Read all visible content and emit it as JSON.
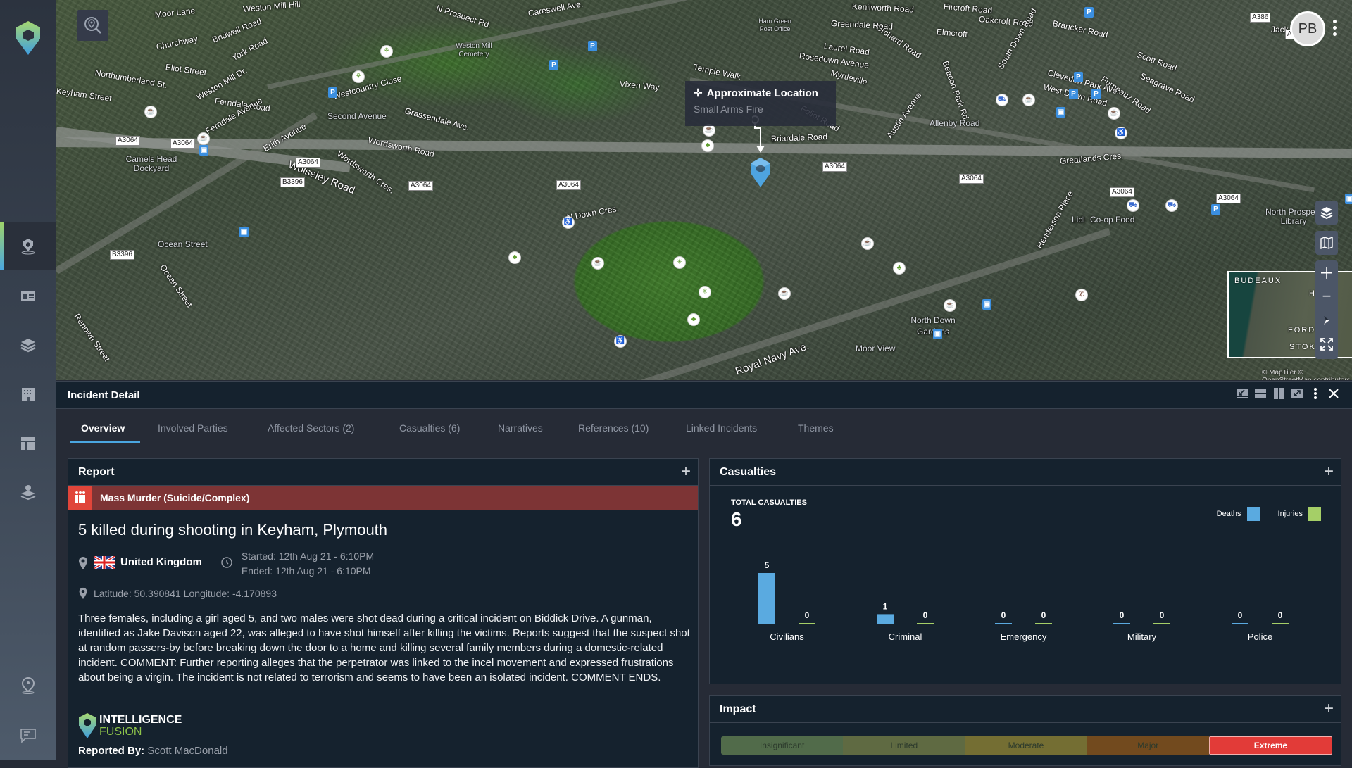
{
  "sidebar": {
    "items": [
      {
        "name": "incidents-map",
        "active": true
      },
      {
        "name": "reports"
      },
      {
        "name": "layers"
      },
      {
        "name": "buildings"
      },
      {
        "name": "dashboard"
      },
      {
        "name": "location-layers"
      }
    ],
    "bottom_items": [
      {
        "name": "my-locations"
      },
      {
        "name": "feedback"
      }
    ]
  },
  "map": {
    "user_initials": "PB",
    "tooltip_title": "Approximate Location",
    "tooltip_subtitle": "Small Arms Fire",
    "attribution": "© MapTiler © OpenStreetMap contributors",
    "minimap_labels": [
      "BUDEAUX",
      "HAM",
      "FORD",
      "STOKE"
    ],
    "street_labels": [
      "Weston Mill Hill",
      "Moor Lane",
      "N Prospect Rd.",
      "Careswell Ave.",
      "Churchway",
      "Bridwell Road",
      "York Road",
      "Eliot Street",
      "Northumberland St.",
      "Keyham Street",
      "Weston Mill Dr.",
      "Ferndale Road",
      "Ferndale Avenue",
      "Westcountry Close",
      "Grassendale Ave.",
      "Wordsworth Road",
      "Wordsworth Cres.",
      "Wolseley Road",
      "Erith Avenue",
      "Vixen Way",
      "Briardale Road",
      "Laurel Road",
      "Rosedown Avenue",
      "Myrtleville",
      "Foliot Road",
      "Austin Avenue",
      "Beacon Park Rd.",
      "Orchard Road",
      "Greendale Road",
      "Kenilworth Road",
      "Fircroft Road",
      "Oakcroft Road",
      "Elmcroft",
      "South Down Road",
      "Brancker Road",
      "Clevedon Park Ave.",
      "West Down Road",
      "Furneaux Road",
      "Scott Road",
      "Seagrave Road",
      "Greatlands Cres.",
      "N Down Cres.",
      "Royal Navy Ave.",
      "Henderson Place",
      "Ocean Street",
      "Renown Street",
      "Temple Walk",
      "Jack Leslie"
    ],
    "poi_labels": [
      "Camels Head Dockyard",
      "Second Avenue",
      "Weston Mill Cemetery",
      "Ham Green Post Office",
      "Allenby Road",
      "Ocean Street",
      "North Down Gardens",
      "Moor View",
      "Lidl",
      "Co-op Food",
      "North Prospect Library"
    ],
    "road_shields": [
      "A3064",
      "B3396",
      "A386"
    ]
  },
  "panel": {
    "title": "Incident Detail",
    "tabs": [
      {
        "label": "Overview",
        "active": true
      },
      {
        "label": "Involved Parties"
      },
      {
        "label": "Affected Sectors (2)"
      },
      {
        "label": "Casualties (6)"
      },
      {
        "label": "Narratives"
      },
      {
        "label": "References (10)"
      },
      {
        "label": "Linked Incidents"
      },
      {
        "label": "Themes"
      }
    ]
  },
  "report": {
    "heading": "Report",
    "category": "Mass Murder (Suicide/Complex)",
    "category_color": "#7d3435",
    "title": "5 killed during shooting in Keyham, Plymouth",
    "country": "United Kingdom",
    "started": "Started: 12th Aug 21 - 6:10PM",
    "ended": "Ended: 12th Aug 21 - 6:10PM",
    "latlng": "Latitude: 50.390841 Longitude: -4.170893",
    "body": "Three females, including a girl aged 5,  and two males were shot dead during a critical incident on Biddick Drive. A gunman, identified as Jake Davison aged 22, was alleged to have shot himself after killing the victims. Reports suggest that the suspect shot at random passers-by before breaking down the door to a home and killing several family members during a domestic-related incident. COMMENT: Further reporting alleges that the perpetrator was linked to the incel movement and expressed frustrations about being a virgin. The incident is not related to terrorism and seems to have been an isolated incident.  COMMENT ENDS.",
    "brand_line1": "INTELLIGENCE",
    "brand_line2": "FUSION",
    "reported_by_label": "Reported By:",
    "reported_by": "Scott MacDonald"
  },
  "casualties": {
    "heading": "Casualties",
    "total_label": "TOTAL CASUALTIES",
    "total": "6",
    "legend": [
      {
        "label": "Deaths",
        "color": "#5aaae0"
      },
      {
        "label": "Injuries",
        "color": "#a5cf67"
      }
    ]
  },
  "chart_data": {
    "type": "bar",
    "categories": [
      "Civilians",
      "Criminal",
      "Emergency",
      "Military",
      "Police"
    ],
    "series": [
      {
        "name": "Deaths",
        "values": [
          5,
          1,
          0,
          0,
          0
        ],
        "color": "#5aaae0"
      },
      {
        "name": "Injuries",
        "values": [
          0,
          0,
          0,
          0,
          0
        ],
        "color": "#a5cf67"
      }
    ],
    "title": "",
    "xlabel": "",
    "ylabel": "",
    "ylim": [
      0,
      5
    ],
    "grid": false,
    "legend": "top-right"
  },
  "impact": {
    "heading": "Impact",
    "levels": [
      {
        "label": "Insignificant",
        "color": "#516b4a"
      },
      {
        "label": "Limited",
        "color": "#5f6a42"
      },
      {
        "label": "Moderate",
        "color": "#746e33"
      },
      {
        "label": "Major",
        "color": "#724a1e"
      },
      {
        "label": "Extreme",
        "color": "#e23b38"
      }
    ],
    "selected": "Extreme"
  }
}
